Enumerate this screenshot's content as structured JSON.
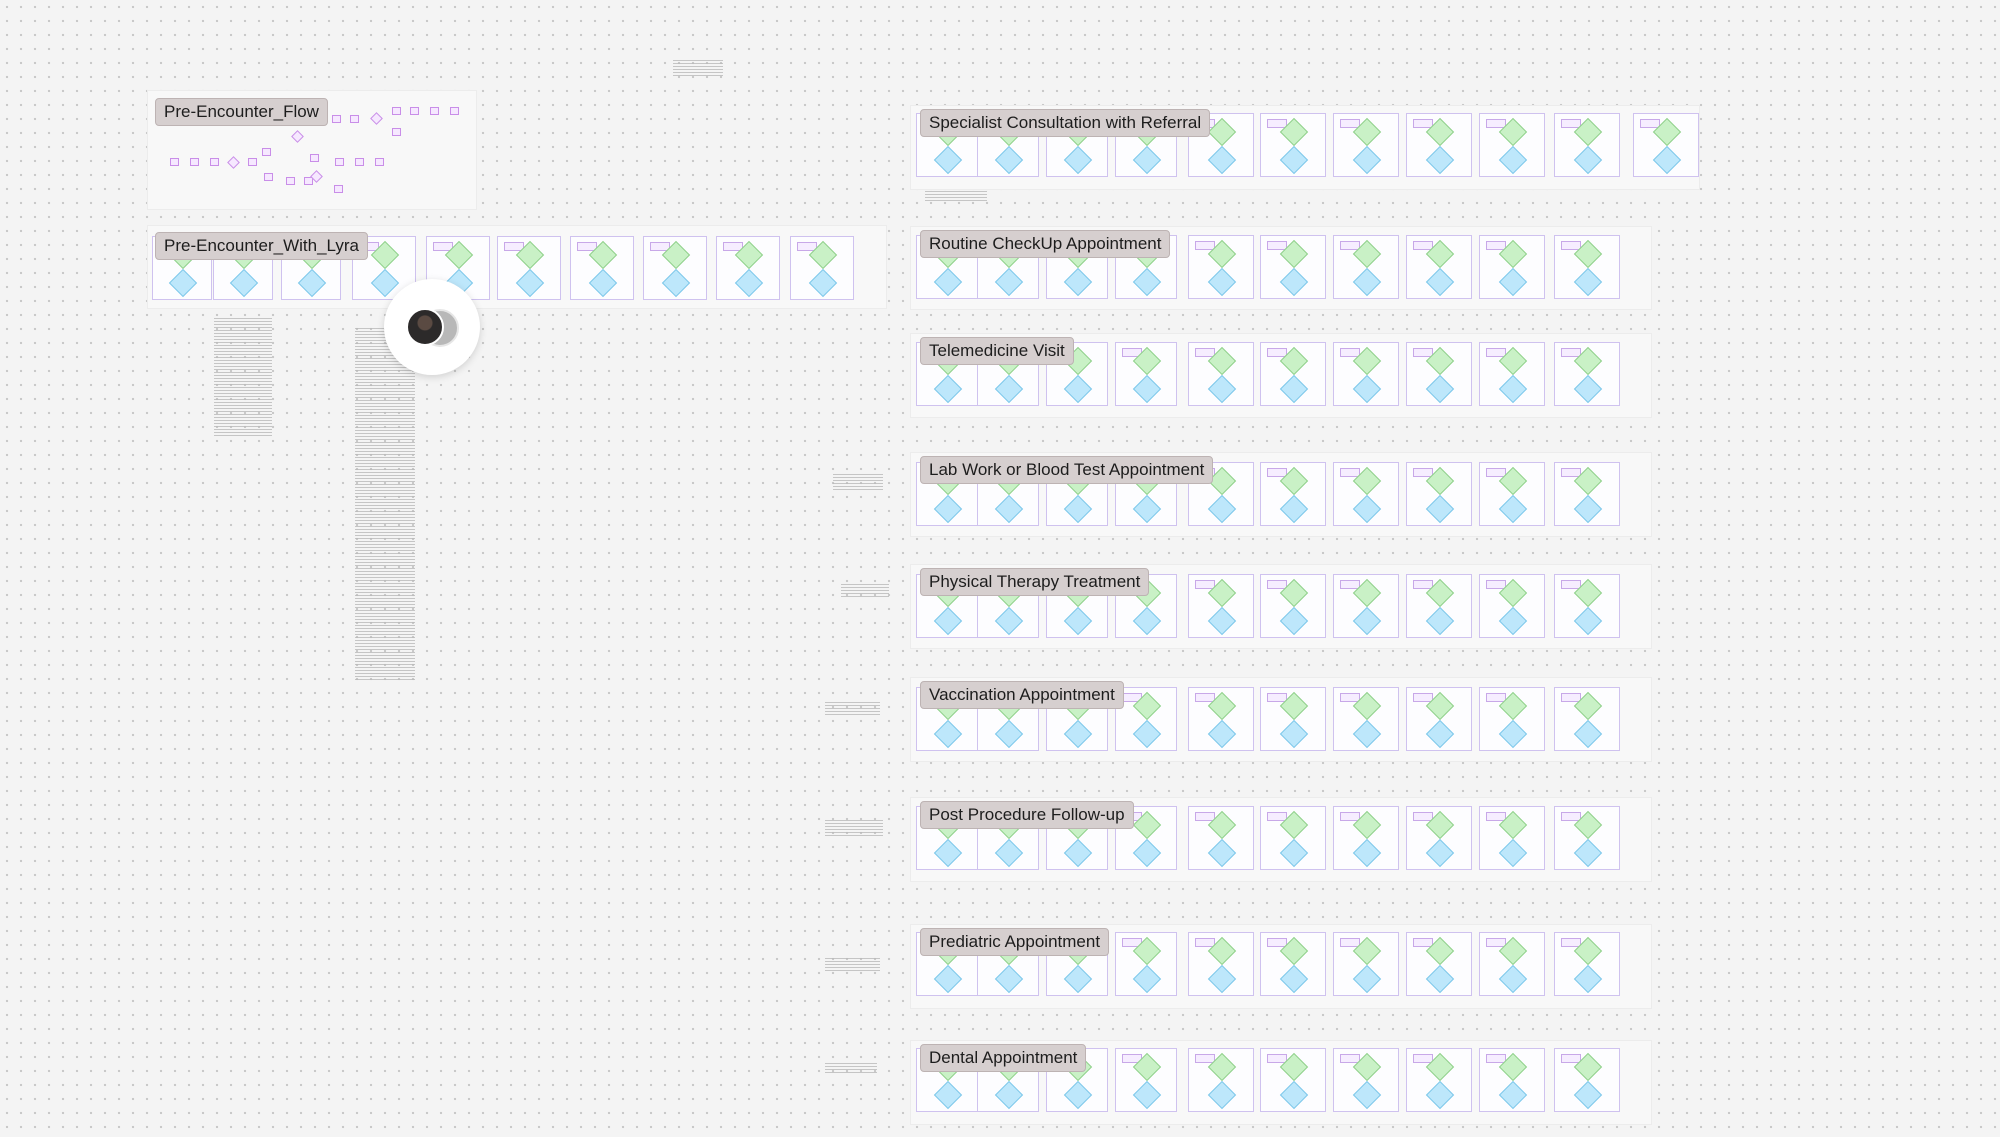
{
  "flows": [
    {
      "id": "pre-encounter-flow",
      "label": "Pre-Encounter_Flow"
    },
    {
      "id": "pre-encounter-with-lyra",
      "label": "Pre-Encounter_With_Lyra"
    },
    {
      "id": "specialist-consultation",
      "label": "Specialist Consultation with Referral"
    },
    {
      "id": "routine-checkup",
      "label": "Routine CheckUp Appointment"
    },
    {
      "id": "telemedicine-visit",
      "label": "Telemedicine Visit"
    },
    {
      "id": "lab-work",
      "label": "Lab Work or Blood Test Appointment"
    },
    {
      "id": "physical-therapy",
      "label": "Physical Therapy Treatment"
    },
    {
      "id": "vaccination",
      "label": "Vaccination Appointment"
    },
    {
      "id": "post-procedure",
      "label": "Post Procedure Follow-up"
    },
    {
      "id": "prediatric",
      "label": "Prediatric Appointment"
    },
    {
      "id": "dental",
      "label": "Dental Appointment"
    }
  ],
  "collaborator": {
    "icon": "user-avatar-icon"
  },
  "colors": {
    "canvas": "#f4f4f4",
    "label_bg": "#d6cfcf",
    "frame_border": "#cfc2ef",
    "decision_green": "#c9f1c6",
    "decision_blue": "#bde7fb"
  }
}
